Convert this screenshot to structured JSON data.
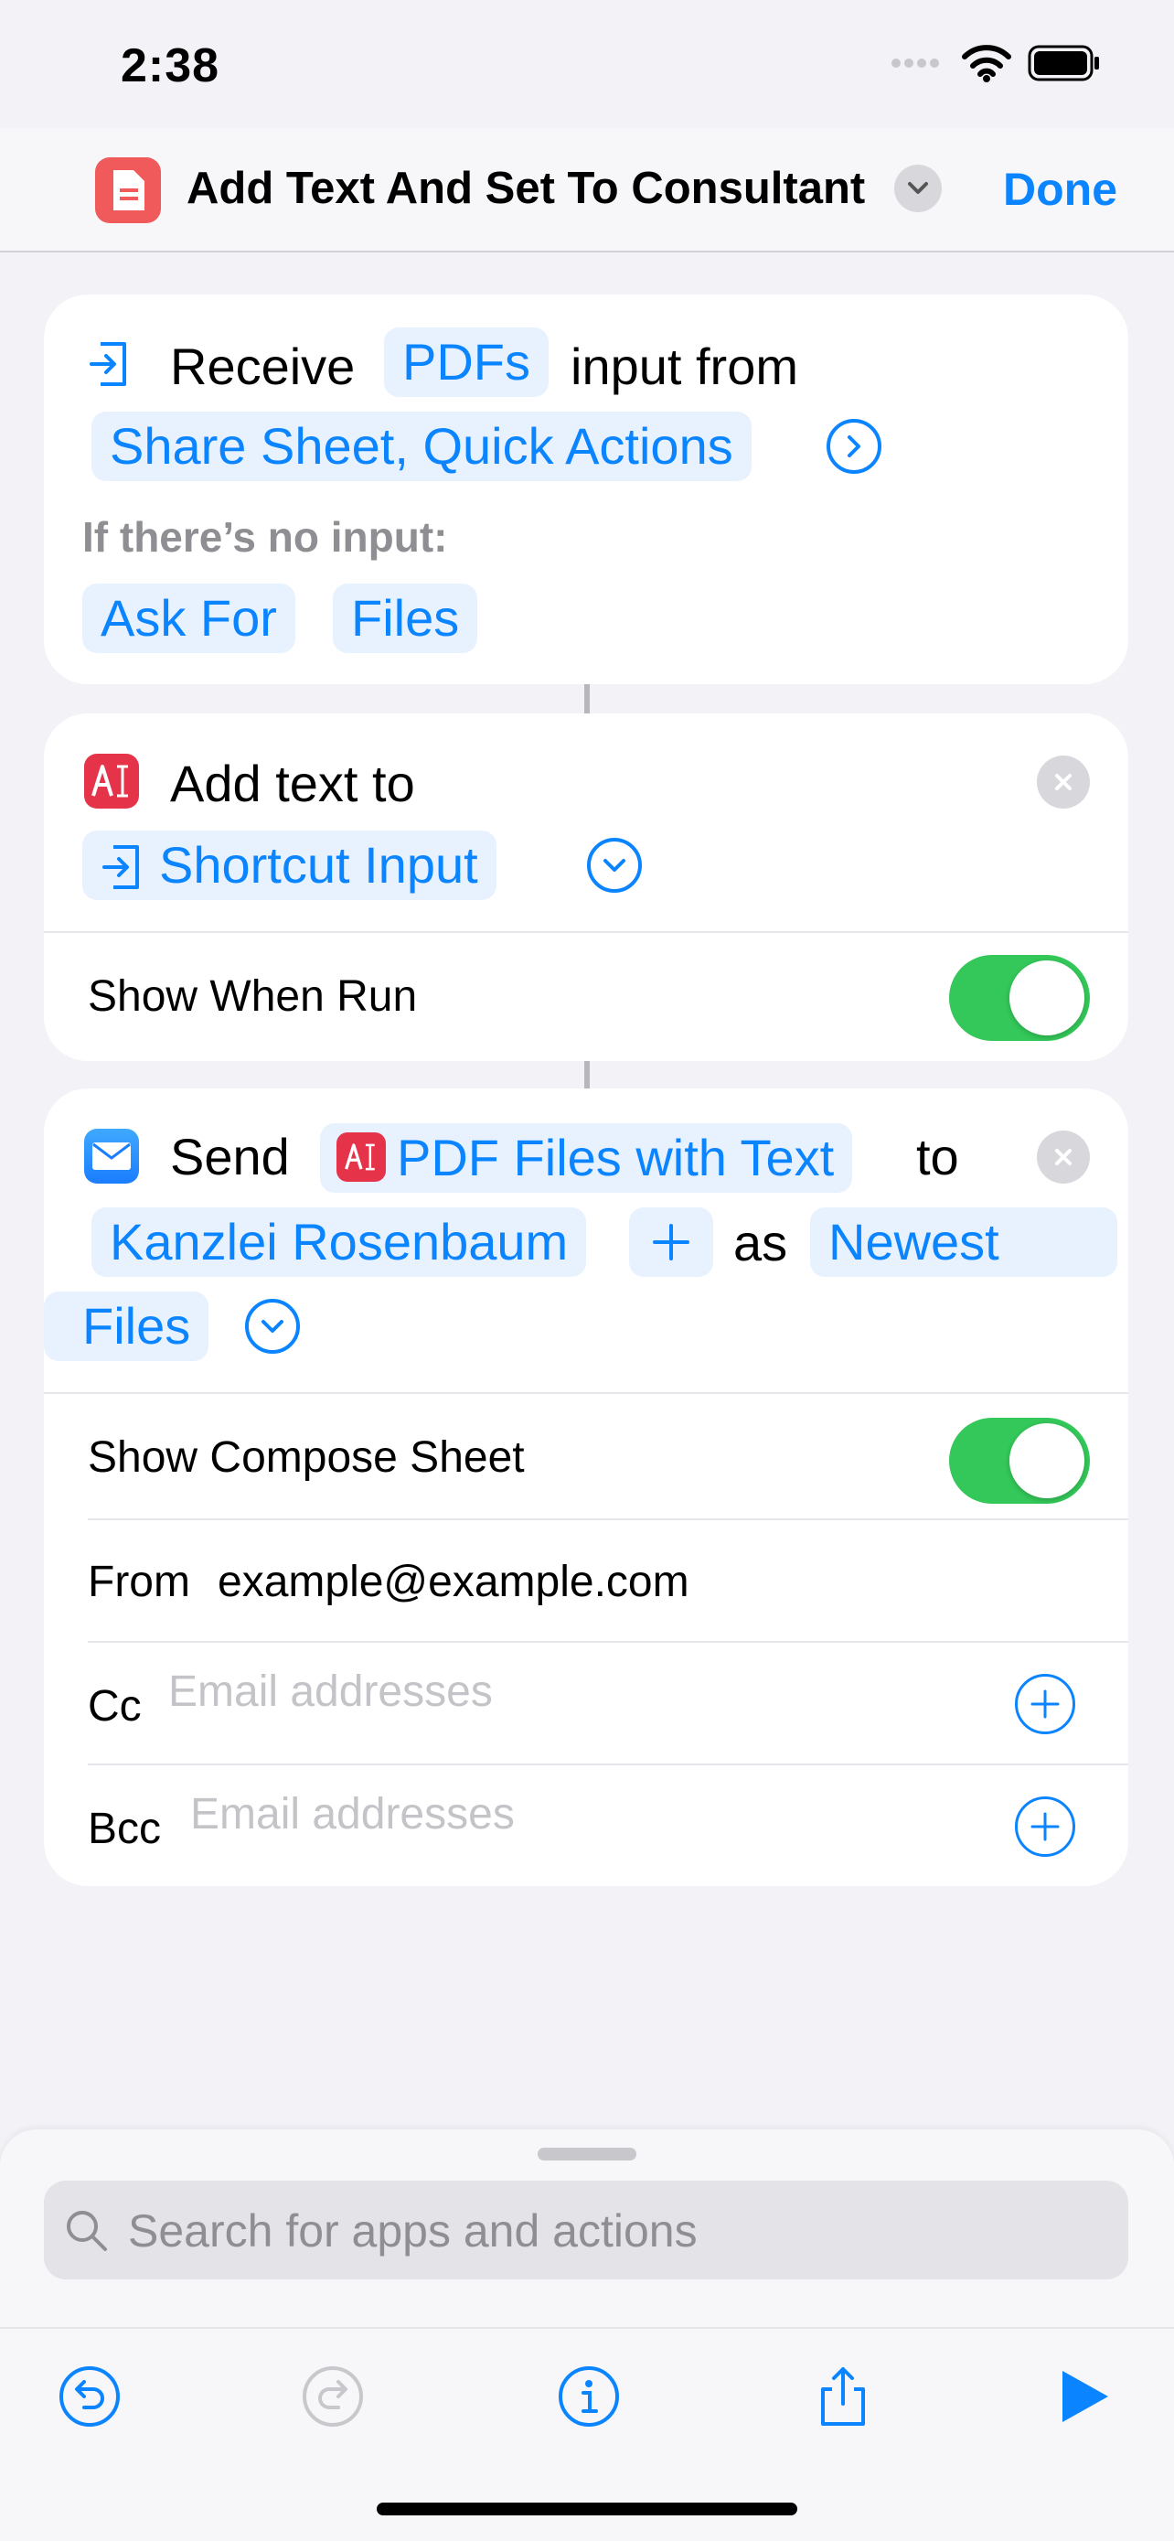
{
  "status": {
    "time": "2:38"
  },
  "header": {
    "title": "Add Text And Set To Consultant",
    "done": "Done"
  },
  "receive_card": {
    "receive": "Receive",
    "pdfs": "PDFs",
    "input_from": "input from",
    "sources": "Share Sheet, Quick Actions",
    "no_input_label": "If there’s no input:",
    "ask_for": "Ask For",
    "files": "Files"
  },
  "addtext_card": {
    "title": "Add text to",
    "target": "Shortcut Input",
    "show_when_run": "Show When Run"
  },
  "send_card": {
    "send": "Send",
    "item": "PDF Files with Text",
    "to": "to",
    "recipient": "Kanzlei Rosenbaum",
    "as": "as",
    "newest": "Newest",
    "files": "Files",
    "show_compose": "Show Compose Sheet",
    "from_label": "From",
    "from_value": "example@example.com",
    "cc_label": "Cc",
    "cc_placeholder": "Email addresses",
    "bcc_label": "Bcc",
    "bcc_placeholder": "Email addresses"
  },
  "bottom": {
    "search_placeholder": "Search for apps and actions"
  },
  "colors": {
    "accent": "#0a84ff",
    "toggle_on": "#34c759",
    "app_icon": "#f05a5a"
  },
  "icons": [
    "cellular-icon",
    "wifi-icon",
    "battery-icon",
    "document-icon",
    "chevron-down-icon",
    "input-icon",
    "chevron-right-icon",
    "text-cursor-icon",
    "close-icon",
    "mail-icon",
    "plus-icon",
    "search-icon",
    "undo-icon",
    "redo-icon",
    "info-icon",
    "share-icon",
    "play-icon"
  ]
}
